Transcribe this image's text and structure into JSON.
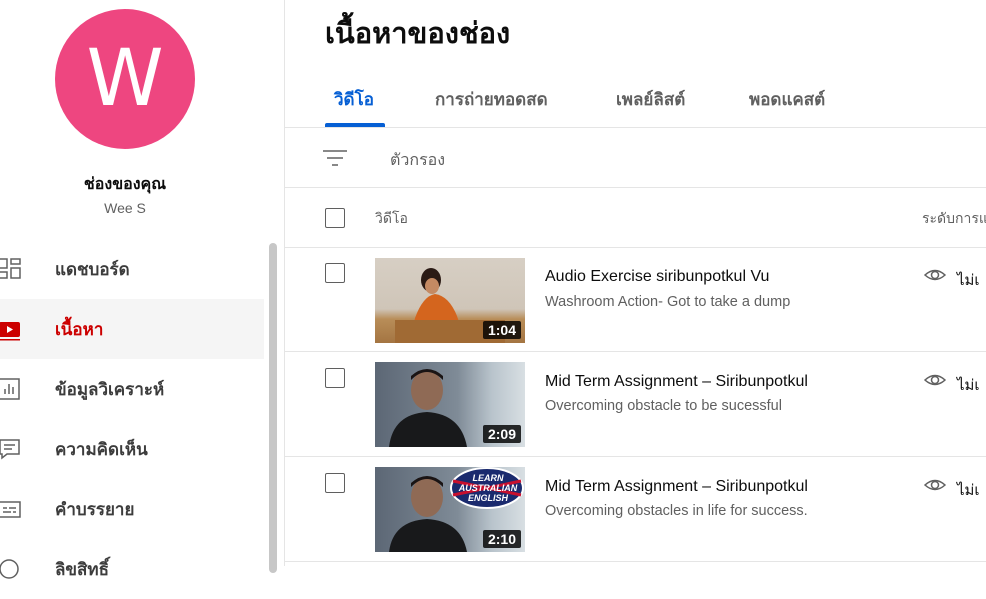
{
  "channel": {
    "avatar_letter": "W",
    "avatar_color": "#ee4680",
    "title": "ช่องของคุณ",
    "name": "Wee S"
  },
  "sidebar": {
    "items": [
      {
        "label": "แดชบอร์ด",
        "icon": "dashboard-icon",
        "active": false
      },
      {
        "label": "เนื้อหา",
        "icon": "content-icon",
        "active": true
      },
      {
        "label": "ข้อมูลวิเคราะห์",
        "icon": "analytics-icon",
        "active": false
      },
      {
        "label": "ความคิดเห็น",
        "icon": "comments-icon",
        "active": false
      },
      {
        "label": "คำบรรยาย",
        "icon": "subtitles-icon",
        "active": false
      },
      {
        "label": "ลิขสิทธิ์",
        "icon": "copyright-icon",
        "active": false
      }
    ]
  },
  "main": {
    "title": "เนื้อหาของช่อง",
    "tabs": [
      {
        "label": "วิดีโอ",
        "active": true
      },
      {
        "label": "การถ่ายทอดสด",
        "active": false
      },
      {
        "label": "เพลย์ลิสต์",
        "active": false
      },
      {
        "label": "พอดแคสต์",
        "active": false
      }
    ],
    "filter_label": "ตัวกรอง",
    "columns": {
      "video": "วิดีโอ",
      "visibility": "ระดับการแ"
    },
    "videos": [
      {
        "title": "Audio Exercise siribunpotkul Vu",
        "description": "Washroom Action- Got to take a dump",
        "duration": "1:04",
        "visibility": "ไม่เ"
      },
      {
        "title": "Mid Term Assignment – Siribunpotkul",
        "description": "Overcoming obstacle to be sucessful",
        "duration": "2:09",
        "visibility": "ไม่เ"
      },
      {
        "title": "Mid Term Assignment – Siribunpotkul",
        "description": "Overcoming obstacles in life for success.",
        "duration": "2:10",
        "visibility": "ไม่เ",
        "thumb_badge": "LEARN AUSTRALIAN ENGLISH"
      }
    ]
  },
  "colors": {
    "accent": "#065fd4",
    "active_nav": "#cc0000"
  }
}
